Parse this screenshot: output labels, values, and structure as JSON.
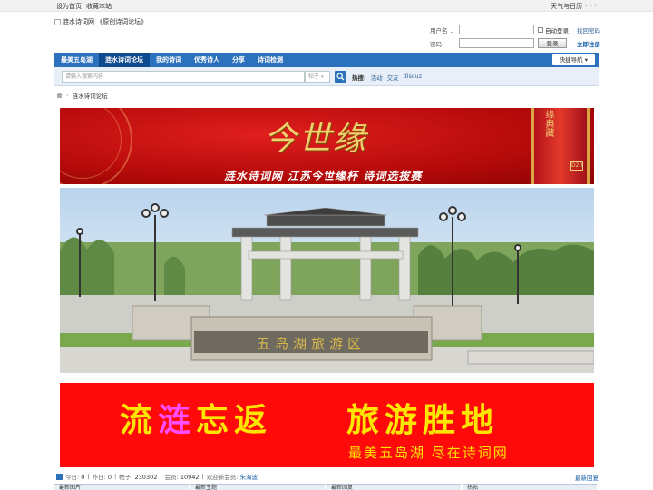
{
  "topbar": {
    "left_links": [
      "设为首页",
      "收藏本站"
    ],
    "right_text": "天气与日历",
    "right_arrows": "› ‹ ›"
  },
  "logo": {
    "alt_text": "涟水诗词网 《原创诗词论坛》"
  },
  "login": {
    "username_label": "用户名",
    "password_label": "密码",
    "remember_label": "自动登录",
    "login_button": "登录",
    "forgot_link": "找回密码",
    "register_link": "立即注册"
  },
  "nav": {
    "items": [
      "最美五岛湖",
      "涟水诗词论坛",
      "我的诗词",
      "优秀诗人",
      "分享",
      "诗词检测"
    ],
    "active_index": 1,
    "quick_nav": "快捷导航"
  },
  "search": {
    "placeholder": "请输入搜索内容",
    "scope": "帖子",
    "hot_label": "热搜:",
    "hot_links": [
      "活动",
      "交友",
      "discuz"
    ]
  },
  "breadcrumb": {
    "separator": "›",
    "current": "涟水诗词论坛"
  },
  "banner1": {
    "calligraphy": "今世缘",
    "subtitle": "涟水诗词网  江苏今世缘杯  诗词选拔赛",
    "jar_label": "缘典藏",
    "jar_code": "D20"
  },
  "banner2": {
    "line1_a": "流",
    "line1_b": "涟",
    "line1_c": "忘返",
    "line1_d": "旅游胜地",
    "line2": "最美五岛湖  尽在诗词网"
  },
  "photo": {
    "monument_text": "五岛湖旅游区"
  },
  "stats": {
    "today_label": "今日:",
    "today": "0",
    "yesterday_label": "昨日:",
    "yesterday": "0",
    "posts_label": "帖子:",
    "posts": "230302",
    "members_label": "会员:",
    "members": "10942",
    "welcome_label": "欢迎新会员:",
    "newest_member": "朱海波",
    "newest_reply": "最新回复"
  },
  "columns": [
    "最新图片",
    "最新主题",
    "最新回复",
    "热帖"
  ]
}
